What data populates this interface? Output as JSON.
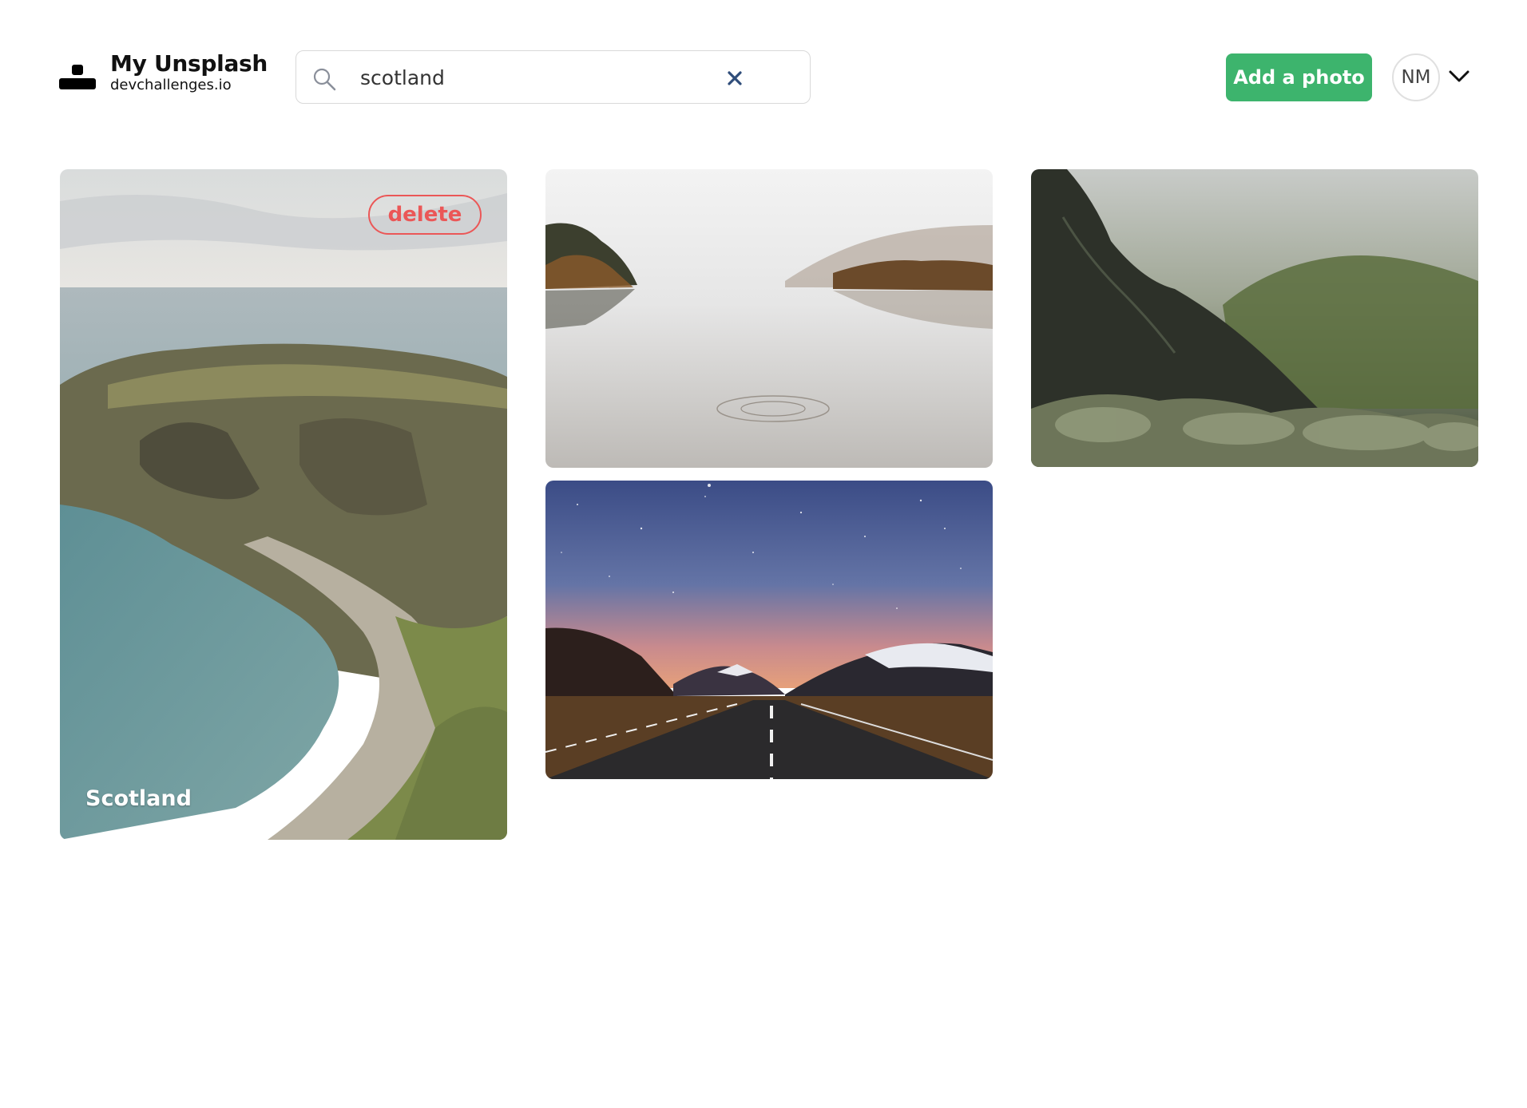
{
  "header": {
    "brand_title": "My Unsplash",
    "brand_subtitle": "devchallenges.io",
    "search": {
      "value": "scotland",
      "placeholder": "Search by name"
    },
    "add_photo_label": "Add a photo",
    "user_initials": "NM"
  },
  "colors": {
    "accent_green": "#3db46d",
    "delete_red": "#eb5757",
    "text_dark": "#111111"
  },
  "icons": {
    "logo": "unsplash-logo-icon",
    "search": "search-icon",
    "clear": "close-icon",
    "menu": "chevron-down-icon"
  },
  "gallery": {
    "photos": [
      {
        "label": "Scotland",
        "delete_label": "delete",
        "subject": "coastal cliffs and beach"
      },
      {
        "subject": "misty loch"
      },
      {
        "subject": "starry sky over road"
      },
      {
        "subject": "foggy mountain ridge"
      }
    ]
  }
}
